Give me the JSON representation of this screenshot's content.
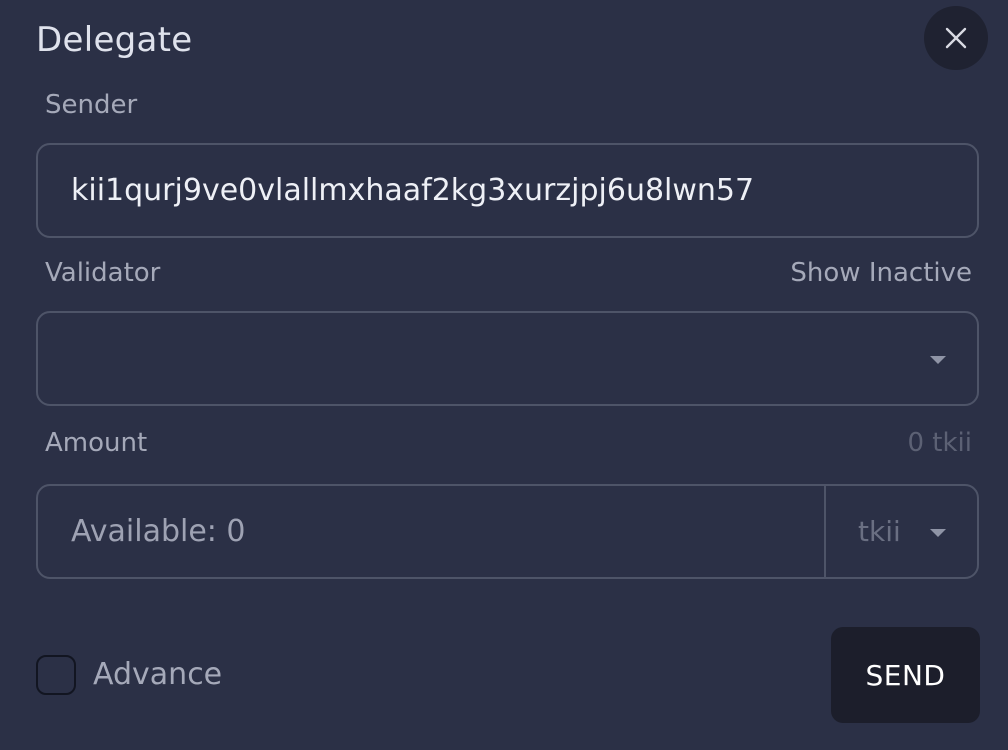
{
  "dialog": {
    "title": "Delegate",
    "close_icon": "close-icon"
  },
  "sender": {
    "label": "Sender",
    "value": "kii1qurj9ve0vlallmxhaaf2kg3xurzjpj6u8lwn57"
  },
  "validator": {
    "label": "Validator",
    "toggle_label": "Show Inactive",
    "selected_value": "",
    "caret_icon": "chevron-down-icon"
  },
  "amount": {
    "label": "Amount",
    "balance": "0 tkii",
    "placeholder": "Available: 0",
    "value": "",
    "denom": "tkii",
    "caret_icon": "chevron-down-icon"
  },
  "advance": {
    "label": "Advance",
    "checked": false
  },
  "actions": {
    "send_label": "SEND"
  },
  "colors": {
    "background": "#2b3046",
    "field_border": "#4e5468",
    "send_button": "#1c1e2b",
    "close_button": "#1f2231"
  }
}
